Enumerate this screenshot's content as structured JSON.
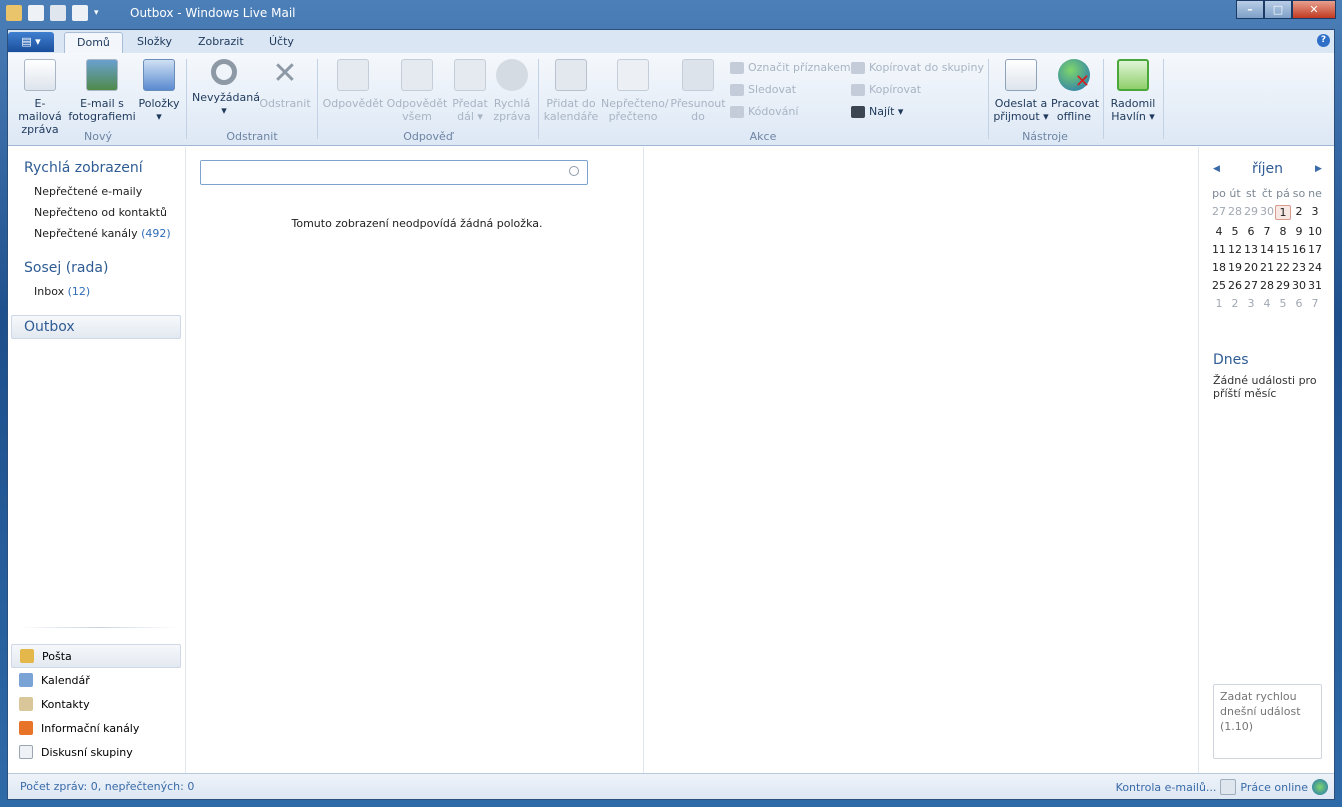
{
  "window": {
    "title": "Outbox - Windows Live Mail",
    "min": "–",
    "max": "□",
    "close": "✕"
  },
  "tabs": {
    "app_menu": "▤ ▾",
    "items": [
      "Domů",
      "Složky",
      "Zobrazit",
      "Účty"
    ],
    "help": "?"
  },
  "ribbon": {
    "new": {
      "email": [
        "E-mailová",
        "zpráva"
      ],
      "photo": [
        "E-mail s",
        "fotografiemi"
      ],
      "items": [
        "Položky",
        "▾"
      ],
      "group": "Nový"
    },
    "delete": {
      "junk": [
        "Nevyžádaná",
        "▾"
      ],
      "delete": [
        "Odstranit",
        ""
      ],
      "group": "Odstranit"
    },
    "respond": {
      "reply": [
        "Odpovědět",
        ""
      ],
      "reply_all": [
        "Odpovědět",
        "všem"
      ],
      "forward": [
        "Předat",
        "dál ▾"
      ],
      "im": [
        "Rychlá",
        "zpráva"
      ],
      "group": "Odpověď"
    },
    "actions": {
      "calendar": [
        "Přidat do",
        "kalendáře"
      ],
      "unread": [
        "Nepřečteno/",
        "přečteno"
      ],
      "move": [
        "Přesunout",
        "do"
      ],
      "flag": "Označit příznakem",
      "watch": "Sledovat",
      "encoding": "Kódování",
      "copy_group": "Kopírovat do skupiny",
      "copy": "Kopírovat",
      "find": "Najít ▾",
      "group": "Akce"
    },
    "tools": {
      "send_receive": [
        "Odeslat a",
        "přijmout ▾"
      ],
      "offline": [
        "Pracovat",
        "offline"
      ],
      "group": "Nástroje"
    },
    "user": {
      "name": [
        "Radomil",
        "Havlín ▾"
      ]
    }
  },
  "left": {
    "quick_views": {
      "title": "Rychlá zobrazení",
      "items": [
        {
          "label": "Nepřečtené e-maily",
          "count": ""
        },
        {
          "label": "Nepřečteno od kontaktů",
          "count": ""
        },
        {
          "label": "Nepřečtené kanály",
          "count": "(492)"
        }
      ]
    },
    "account": {
      "title": "Sosej (rada)",
      "inbox": "Inbox",
      "inbox_count": "(12)"
    },
    "outbox": "Outbox",
    "nav": [
      "Pošta",
      "Kalendář",
      "Kontakty",
      "Informační kanály",
      "Diskusní skupiny"
    ]
  },
  "list": {
    "search_placeholder": "",
    "empty": "Tomuto zobrazení neodpovídá žádná položka."
  },
  "calendar": {
    "month": "říjen",
    "weekdays": [
      "po",
      "út",
      "st",
      "čt",
      "pá",
      "so",
      "ne"
    ],
    "weeks": [
      [
        "27",
        "28",
        "29",
        "30",
        "1",
        "2",
        "3"
      ],
      [
        "4",
        "5",
        "6",
        "7",
        "8",
        "9",
        "10"
      ],
      [
        "11",
        "12",
        "13",
        "14",
        "15",
        "16",
        "17"
      ],
      [
        "18",
        "19",
        "20",
        "21",
        "22",
        "23",
        "24"
      ],
      [
        "25",
        "26",
        "27",
        "28",
        "29",
        "30",
        "31"
      ],
      [
        "1",
        "2",
        "3",
        "4",
        "5",
        "6",
        "7"
      ]
    ],
    "today": "1",
    "today_title": "Dnes",
    "no_events": "Žádné události pro příští měsíc",
    "quick_event_placeholder": "Zadat rychlou dnešní událost (1.10)"
  },
  "status": {
    "left": "Počet zpráv: 0, nepřečtených: 0",
    "check": "Kontrola e-mailů...",
    "online": "Práce online"
  },
  "colors": {
    "accent": "#2f5c94",
    "link": "#2f6cb6"
  }
}
